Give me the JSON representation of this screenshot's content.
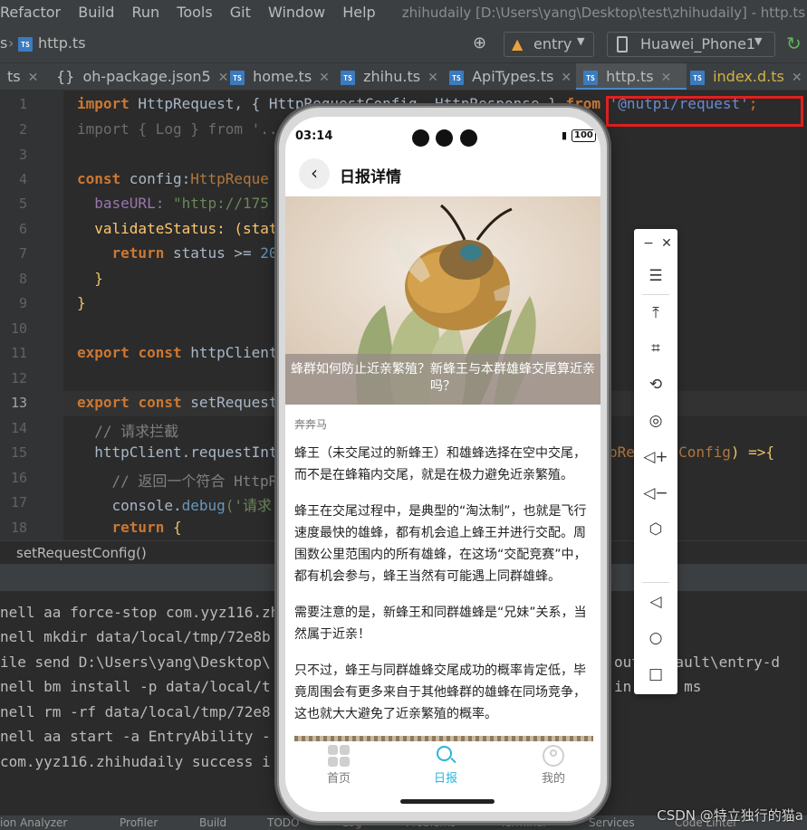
{
  "menubar": {
    "items": [
      "Refactor",
      "Build",
      "Run",
      "Tools",
      "Git",
      "Window",
      "Help"
    ],
    "window_title": "zhihudaily [D:\\Users\\yang\\Desktop\\test\\zhihudaily] - http.ts [entry]"
  },
  "navbar": {
    "breadcrumb_prefix": "s",
    "breadcrumb_file": "http.ts",
    "module_select": "entry",
    "device_select": "Huawei_Phone1"
  },
  "tabs": [
    {
      "label": "ts"
    },
    {
      "label": "oh-package.json5"
    },
    {
      "label": "home.ts"
    },
    {
      "label": "zhihu.ts"
    },
    {
      "label": "ApiTypes.ts"
    },
    {
      "label": "http.ts"
    },
    {
      "label": "index.d.ts"
    }
  ],
  "editor": {
    "line_numbers": [
      "1",
      "2",
      "3",
      "4",
      "5",
      "6",
      "7",
      "8",
      "9",
      "10",
      "11",
      "12",
      "13",
      "14",
      "15",
      "16",
      "17",
      "18"
    ],
    "lines": {
      "l1a": "import",
      "l1b": " HttpRequest, { HttpRequestConfig, HttpResponse } ",
      "l1c": "from",
      "l1d": " ",
      "l1e": "'@nutpi/request'",
      "l1f": ";",
      "l2": "import { Log } from '../",
      "l4a": "const",
      "l4b": " config:",
      "l4c": "HttpReque",
      "l5a": "  baseURL: ",
      "l5b": "\"http://175",
      "l6a": "  validateStatus: (stat",
      "l7a": "    return",
      "l7b": " status >= ",
      "l7c": "20",
      "l8": "  }",
      "l9": "}",
      "l11a": "export",
      "l11b": " ",
      "l11c": "const",
      "l11d": " httpClient",
      "l13a": "export",
      "l13b": " ",
      "l13c": "const",
      "l13d": " setRequest",
      "l14": "  // 请求拦截",
      "l15a": "  httpClient.requestInt",
      "l15b": "pRequestConfig",
      "l15c": ") =>{",
      "l15d": "t",
      "l16": "    // 返回一个符合 HttpR",
      "l17a": "    console.",
      "l17b": "debug",
      "l17c": "('请求",
      "l18a": "    return",
      "l18b": " {"
    }
  },
  "breadcrumb_bottom": "setRequestConfig()",
  "terminal": {
    "lines": [
      "nell aa force-stop com.yyz116.zhihudaily",
      "nell mkdir data/local/tmp/72e8b",
      "ile send D:\\Users\\yang\\Desktop\\",
      "nell bm install -p data/local/t",
      "nell rm -rf data/local/tmp/72e8",
      "nell aa start -a EntryAbility -",
      "com.yyz116.zhihudaily success i"
    ],
    "right_fragments": {
      "r1": "out\\default\\entry-d",
      "r2": "in      ms"
    }
  },
  "statusbar": {
    "items": [
      "ion Analyzer",
      "Profiler",
      "Build",
      "TODO",
      "Log",
      "Problems",
      "Terminal",
      "Services",
      "Code Linter"
    ]
  },
  "watermark": "CSDN @特立独行的猫a",
  "phone": {
    "time": "03:14",
    "battery": "100",
    "page_title": "日报详情",
    "hero_caption": "蜂群如何防止近亲繁殖？新蜂王与本群雄蜂交尾算近亲吗？",
    "author": "奔奔马",
    "paragraphs": [
      "蜂王（未交尾过的新蜂王）和雄蜂选择在空中交尾，而不是在蜂箱内交尾，就是在极力避免近亲繁殖。",
      "蜂王在交尾过程中，是典型的“淘汰制”，也就是飞行速度最快的雄蜂，都有机会追上蜂王并进行交配。周围数公里范围内的所有雄蜂，在这场“交配竞赛”中，都有机会参与，蜂王当然有可能遇上同群雄蜂。",
      "需要注意的是，新蜂王和同群雄蜂是“兄妹”关系，当然属于近亲！",
      "只不过，蜂王与同群雄蜂交尾成功的概率肯定低，毕竟周围会有更多来自于其他蜂群的雄蜂在同场竞争，这也就大大避免了近亲繁殖的概率。"
    ],
    "tabs": [
      {
        "label": "首页",
        "active": false
      },
      {
        "label": "日报",
        "active": true
      },
      {
        "label": "我的",
        "active": false
      }
    ],
    "accent_color": "#2bb5d8"
  },
  "emulator_panel": {
    "icons": [
      "minimize-icon",
      "close-icon",
      "menu-icon",
      "pin-top-icon",
      "crop-icon",
      "rotate-icon",
      "screenshot-icon",
      "volume-up-icon",
      "volume-down-icon",
      "shake-icon",
      "back-icon",
      "home-icon",
      "recents-icon"
    ]
  }
}
